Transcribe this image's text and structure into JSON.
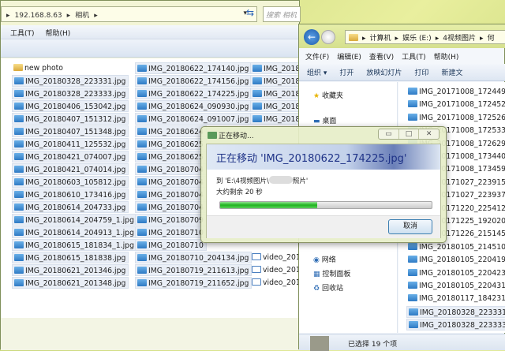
{
  "left_window": {
    "address": [
      "192.168.8.63",
      "相机"
    ],
    "search_placeholder": "搜索 相机",
    "menu": [
      "工具(T)",
      "帮助(H)"
    ],
    "col1": [
      "new photo",
      "IMG_20180328_223331.jpg",
      "IMG_20180328_223333.jpg",
      "IMG_20180406_153042.jpg",
      "IMG_20180407_151312.jpg",
      "IMG_20180407_151348.jpg",
      "IMG_20180411_125532.jpg",
      "IMG_20180421_074007.jpg",
      "IMG_20180421_074014.jpg",
      "IMG_20180603_105812.jpg",
      "IMG_20180610_173416.jpg",
      "IMG_20180614_204733.jpg",
      "IMG_20180614_204759_1.jpg",
      "IMG_20180614_204913_1.jpg",
      "IMG_20180615_181834_1.jpg",
      "IMG_20180615_181838.jpg",
      "IMG_20180621_201346.jpg",
      "IMG_20180621_201348.jpg"
    ],
    "col2": [
      "IMG_20180622_174140.jpg",
      "IMG_20180622_174156.jpg",
      "IMG_20180622_174225.jpg",
      "IMG_20180624_090930.jpg",
      "IMG_20180624_091007.jpg",
      "IMG_20180624",
      "IMG_20180625",
      "IMG_20180625",
      "IMG_20180704",
      "IMG_20180704",
      "IMG_20180704",
      "IMG_20180704",
      "IMG_20180709",
      "IMG_20180710",
      "IMG_20180710",
      "IMG_20180710_204134.jpg",
      "IMG_20180719_211613.jpg",
      "IMG_20180719_211652.jpg"
    ],
    "col3_top": [
      "IMG_2018",
      "IMG_2018",
      "IMG_2018",
      "IMG_2018",
      "IMG_2018"
    ],
    "col3_bottom": [
      "video_201",
      "video_201",
      "video_201"
    ]
  },
  "right_window": {
    "address": [
      "计算机",
      "娱乐 (E:)",
      "4视频图片",
      "何"
    ],
    "menu": [
      "文件(F)",
      "编辑(E)",
      "查看(V)",
      "工具(T)",
      "帮助(H)"
    ],
    "toolbar": [
      "组织 ▾",
      "打开",
      "放映幻灯片",
      "打印",
      "新建文"
    ],
    "sidebar": [
      {
        "label": "收藏夹",
        "icon": "star-icon"
      },
      {
        "label": "桌面",
        "icon": "desktop-icon"
      },
      {
        "label": "网络",
        "icon": "network-icon"
      },
      {
        "label": "控制面板",
        "icon": "control-panel-icon"
      },
      {
        "label": "回收站",
        "icon": "recycle-bin-icon"
      }
    ],
    "files": [
      "IMG_20171008_172449.jpg",
      "IMG_20171008_172452.jpg",
      "IMG_20171008_172526.jpg",
      "IMG_20171008_172533.jpg",
      "IMG_20171008_172629.jpg",
      "IMG_20171008_173440.jpg",
      "IMG_20171008_173459.jpg",
      "IMG_20171027_223915.jpg",
      "IMG_20171027_223937.jpg",
      "IMG_20171220_225412.jpg",
      "IMG_20171225_192020.jpg",
      "IMG_20171226_215145.jpg",
      "IMG_20180105_214510.jpg",
      "IMG_20180105_220419.jpg",
      "IMG_20180105_220423.jpg",
      "IMG_20180105_220431.jpg",
      "IMG_20180117_184231_B",
      "IMG_20180328_223331.jpg",
      "IMG_20180328_223333.jpg"
    ],
    "status": "已选择 19 个项"
  },
  "dialog": {
    "title": "正在移动...",
    "heading": "正在移动 'IMG_20180622_174225.jpg'",
    "dest_prefix": "到 'E:\\4视频图片\\",
    "dest_suffix": "照片'",
    "remaining": "大约剩余 20 秒",
    "progress_percent": 46,
    "cancel": "取消",
    "progress_color": "#1fb41f"
  }
}
